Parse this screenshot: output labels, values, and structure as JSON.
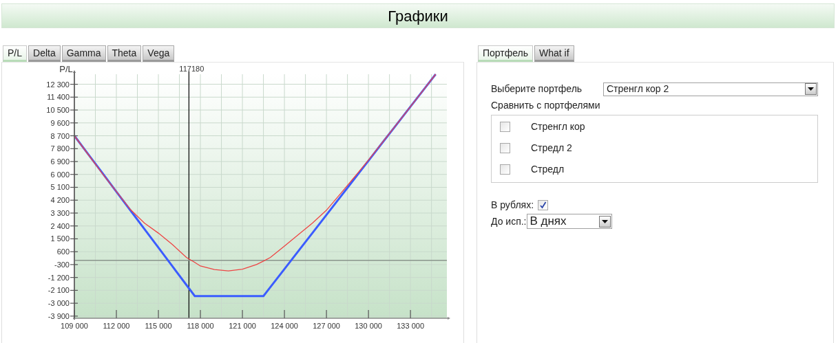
{
  "header": {
    "title": "Графики"
  },
  "chart_panel": {
    "tabs": [
      {
        "label": "P/L",
        "selected": true
      },
      {
        "label": "Delta",
        "selected": false
      },
      {
        "label": "Gamma",
        "selected": false
      },
      {
        "label": "Theta",
        "selected": false
      },
      {
        "label": "Vega",
        "selected": false
      }
    ],
    "chart_data": {
      "type": "line",
      "ylabel": "P/L",
      "x": [
        109000,
        110000,
        111000,
        112000,
        113000,
        114000,
        115000,
        116000,
        117000,
        117600,
        118000,
        119000,
        120000,
        121000,
        122000,
        122500,
        123000,
        124000,
        125000,
        126000,
        127000,
        128000,
        129000,
        130000,
        131000,
        132000,
        133000,
        134000,
        134800
      ],
      "series": [
        {
          "color": "#3b5cff",
          "values": [
            8700,
            7400,
            6100,
            4790,
            3490,
            2190,
            890,
            -420,
            -1720,
            -2500,
            -2500,
            -2500,
            -2500,
            -2500,
            -2500,
            -2500,
            -1870,
            -610,
            650,
            1910,
            3170,
            4430,
            5700,
            6960,
            8220,
            9480,
            10740,
            12000,
            13000
          ]
        },
        {
          "color": "#ee4444",
          "values": [
            8700,
            7380,
            6050,
            4800,
            3550,
            2600,
            1900,
            1100,
            200,
            -150,
            -400,
            -650,
            -740,
            -620,
            -300,
            -60,
            200,
            1000,
            1800,
            2600,
            3500,
            4650,
            5820,
            7000,
            8240,
            9490,
            10740,
            12000,
            13000
          ]
        }
      ],
      "xlim": [
        109000,
        135600
      ],
      "ylim": [
        -4050,
        13000
      ],
      "xticks": [
        {
          "value": 109000,
          "label": "109 000"
        },
        {
          "value": 112000,
          "label": "112 000"
        },
        {
          "value": 115000,
          "label": "115 000"
        },
        {
          "value": 118000,
          "label": "118 000"
        },
        {
          "value": 121000,
          "label": "121 000"
        },
        {
          "value": 124000,
          "label": "124 000"
        },
        {
          "value": 127000,
          "label": "127 000"
        },
        {
          "value": 130000,
          "label": "130 000"
        },
        {
          "value": 133000,
          "label": "133 000"
        }
      ],
      "yticks": [
        {
          "value": 12300,
          "label": "12 300"
        },
        {
          "value": 11400,
          "label": "11 400"
        },
        {
          "value": 10500,
          "label": "10 500"
        },
        {
          "value": 9600,
          "label": "9 600"
        },
        {
          "value": 8700,
          "label": "8 700"
        },
        {
          "value": 7800,
          "label": "7 800"
        },
        {
          "value": 6900,
          "label": "6 900"
        },
        {
          "value": 6000,
          "label": "6 000"
        },
        {
          "value": 5100,
          "label": "5 100"
        },
        {
          "value": 4200,
          "label": "4 200"
        },
        {
          "value": 3300,
          "label": "3 300"
        },
        {
          "value": 2400,
          "label": "2 400"
        },
        {
          "value": 1500,
          "label": "1 500"
        },
        {
          "value": 600,
          "label": "600"
        },
        {
          "value": -300,
          "label": "-300"
        },
        {
          "value": -1200,
          "label": "-1 200"
        },
        {
          "value": -2100,
          "label": "-2 100"
        },
        {
          "value": -3000,
          "label": "-3 000"
        },
        {
          "value": -3900,
          "label": "-3 900"
        }
      ],
      "grid": true,
      "ref_lines": [
        {
          "axis": "x",
          "value": 117180,
          "label": "117180"
        },
        {
          "axis": "y",
          "value": 0
        }
      ]
    }
  },
  "settings_panel": {
    "tabs": [
      {
        "label": "Портфель",
        "selected": true
      },
      {
        "label": "What if",
        "selected": false
      }
    ],
    "portfolio": {
      "label": "Выберите портфель",
      "value": "Стренгл кор 2"
    },
    "compare": {
      "label": "Сравнить с портфелями",
      "items": [
        {
          "label": "Стренгл кор",
          "checked": false
        },
        {
          "label": "Стредл 2",
          "checked": false
        },
        {
          "label": "Стредл",
          "checked": false
        }
      ]
    },
    "in_rubles": {
      "label": "В рублях:",
      "checked": true
    },
    "expiry": {
      "label": "До исп.:",
      "value": "В днях"
    }
  }
}
